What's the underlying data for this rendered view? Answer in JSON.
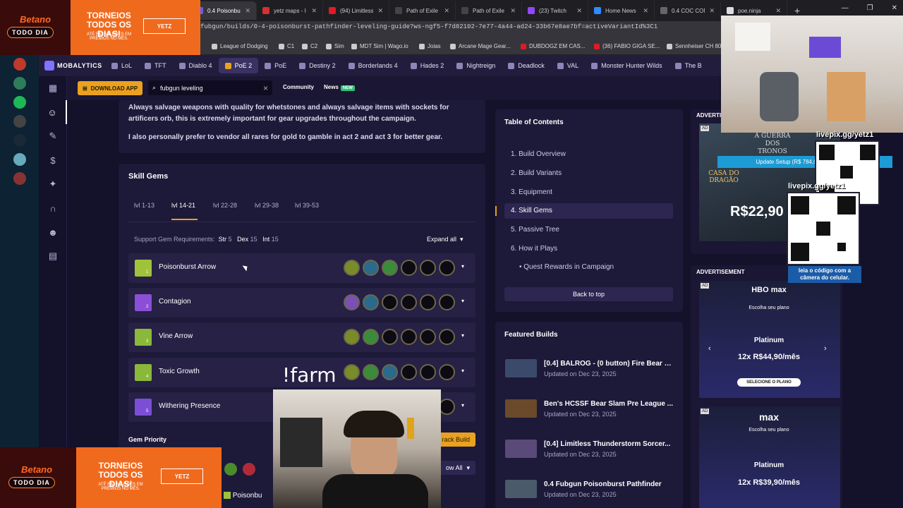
{
  "browser": {
    "tabs": [
      {
        "label": "0.4 Poisonbur",
        "active": true
      },
      {
        "label": "yetz maps - I"
      },
      {
        "label": "(94) Limitless"
      },
      {
        "label": "Path of Exile"
      },
      {
        "label": "Path of Exile"
      },
      {
        "label": "(23) Twitch"
      },
      {
        "label": "Home News"
      },
      {
        "label": "0.4 COC CON"
      },
      {
        "label": "poe.ninja"
      }
    ],
    "url": "fubgun/builds/0-4-poisonburst-pathfinder-leveling-guide?ws-ngf5-f7d82102-7e77-4a44-ad24-33b67e8ae7bf=activeVariantId%3C1",
    "bookmarks": [
      "League of Dodging",
      "C1",
      "C2",
      "Sim",
      "MDT Sim | Wago.io",
      "Joias",
      "Arcane Mage Gear...",
      "DUBDOGZ EM CAS...",
      "(36) FABIO GIGA SE...",
      "Sennheiser CH 80"
    ]
  },
  "nav": {
    "logo": "MOBALYTICS",
    "games": [
      "LoL",
      "TFT",
      "Diablo 4",
      "PoE 2",
      "PoE",
      "Destiny 2",
      "Borderlands 4",
      "Hades 2",
      "Nightreign",
      "Deadlock",
      "VAL",
      "Monster Hunter Wilds",
      "The B"
    ],
    "active_game": "PoE 2",
    "download": "DOWNLOAD APP",
    "search_value": "fubgun leveling",
    "community": "Community",
    "news": "News",
    "news_badge": "NEW"
  },
  "content": {
    "salvage_text": "Always salvage weapons with quality for whetstones and always salvage items with sockets for artificers orb, this is extremely important for gear upgrades throughout the campaign.",
    "vendor_text": "I also personally prefer to vendor all rares for gold to gamble in act 2 and act 3 for better gear.",
    "skill_gems_title": "Skill Gems",
    "level_tabs": [
      "lvl 1-13",
      "lvl 14-21",
      "lvl 22-28",
      "lvl 29-38",
      "lvl 39-53"
    ],
    "active_level_tab": "lvl 14-21",
    "support_req_label": "Support Gem Requirements:",
    "str_label": "Str",
    "str_value": "5",
    "dex_label": "Dex",
    "dex_value": "15",
    "int_label": "Int",
    "int_value": "15",
    "expand_all": "Expand all",
    "gems": [
      {
        "num": "1",
        "name": "Poisonburst Arrow",
        "color": "#9fc23a"
      },
      {
        "num": "2",
        "name": "Contagion",
        "color": "#8a4fd6"
      },
      {
        "num": "3",
        "name": "Vine Arrow",
        "color": "#8ab83a"
      },
      {
        "num": "4",
        "name": "Toxic Growth",
        "color": "#8ab83a"
      },
      {
        "num": "5",
        "name": "Withering Presence",
        "color": "#7a4fd6"
      }
    ],
    "gem_priority": "Gem Priority",
    "track_build": "rack Build",
    "show_all": "ow All",
    "breadcrumb_frag": "Poisonbu"
  },
  "toc": {
    "title": "Table of Contents",
    "items": [
      "1. Build Overview",
      "2. Build Variants",
      "3. Equipment",
      "4. Skill Gems",
      "5. Passive Tree",
      "6. How it Plays"
    ],
    "sub_item": "Quest Rewards in Campaign",
    "back_to_top": "Back to top"
  },
  "featured": {
    "title": "Featured Builds",
    "builds": [
      {
        "title": "[0.4] BALROG - (0 button) Fire Bear S...",
        "date": "Updated on Dec 23, 2025",
        "color": "#3b4a6a"
      },
      {
        "title": "Ben's HCSSF Bear Slam Pre League ...",
        "date": "Updated on Dec 23, 2025",
        "color": "#6a4a2a"
      },
      {
        "title": "[0.4] Limitless Thunderstorm Sorcer...",
        "date": "Updated on Dec 23, 2025",
        "color": "#5a4a7a"
      },
      {
        "title": "0.4 Fubgun Poisonburst Pathfinder",
        "date": "Updated on Dec 23, 2025",
        "color": "#4a5a6a"
      }
    ]
  },
  "ads": {
    "label": "ADVERTISEMENT",
    "ad_tag": "AD",
    "hbo_brand": "HBO max",
    "hbo_choose": "Escolha seu plano",
    "hbo_plan": "Platinum",
    "hbo_price": "12x R$44,90/mês",
    "hbo_cta": "SELECIONE O PLANO",
    "max_brand": "max",
    "max_choose": "Escolha seu plano",
    "max_plan": "Platinum",
    "max_price": "12x R$39,90/mês",
    "got_title": "A GUERRA DOS TRONOS",
    "got_price": "R$22,90",
    "got_sub": "CASA DO DRAGÃO"
  },
  "overlay": {
    "betano": "Betano",
    "todo_dia": "TODO DIA",
    "torneios": "TORNEIOS TODOS OS DIAS!",
    "premios": "ATÉ R$2 MILHÕES EM PRÊMIOS NO MÊS.",
    "yetz": "YETZ",
    "livepix": "livepix.gg/yetz1",
    "update_setup": "Update Setup (R$ 784,06/R$ 1.000,00)",
    "leia": "leia o código com a câmera do celular.",
    "farm": "!farm"
  },
  "colors": {
    "accent": "#e9a11f",
    "bg": "#14112a",
    "panel": "#1d1938",
    "betano": "#f06a1e"
  }
}
